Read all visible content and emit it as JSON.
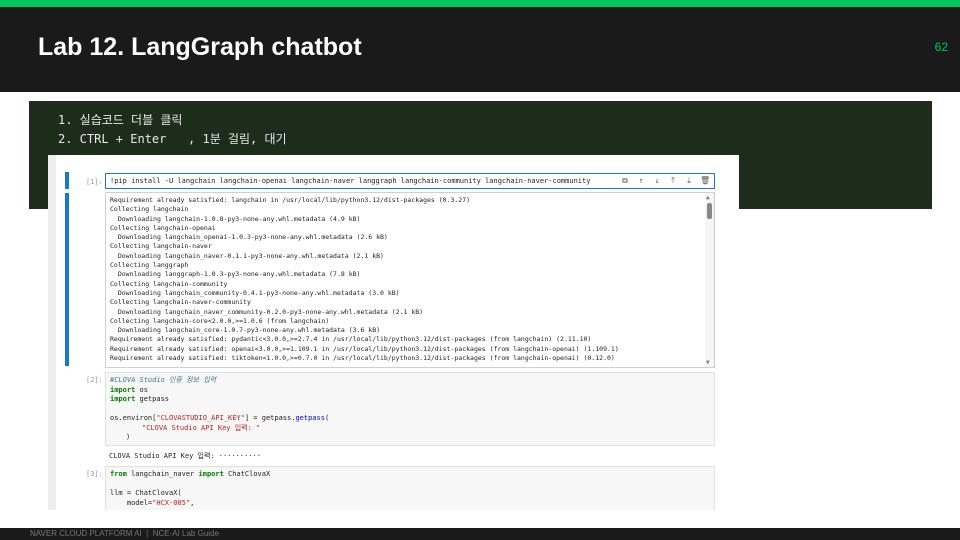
{
  "slide": {
    "title": "Lab 12. LangGraph chatbot",
    "page_number": "62",
    "footer": "NAVER CLOUD PLATFORM AI  |  NCE-AI Lab Guide"
  },
  "instructions": {
    "line1": "1. 실습코드 더블 클릭",
    "line2": "2. CTRL + Enter   , 1분 걸림, 대기"
  },
  "notebook": {
    "cell1": {
      "prompt": "[1]:",
      "code": "!pip install -U langchain langchain-openai langchain-naver langgraph langchain-community langchain-naver-community",
      "toolbar_icons": [
        "copy-icon",
        "arrow-up-icon",
        "arrow-down-icon",
        "insert-above-icon",
        "insert-below-icon",
        "delete-icon"
      ],
      "output": [
        "Requirement already satisfied: langchain in /usr/local/lib/python3.12/dist-packages (0.3.27)",
        "Collecting langchain",
        "  Downloading langchain-1.0.8-py3-none-any.whl.metadata (4.9 kB)",
        "Collecting langchain-openai",
        "  Downloading langchain_openai-1.0.3-py3-none-any.whl.metadata (2.6 kB)",
        "Collecting langchain-naver",
        "  Downloading langchain_naver-0.1.1-py3-none-any.whl.metadata (2.1 kB)",
        "Collecting langgraph",
        "  Downloading langgraph-1.0.3-py3-none-any.whl.metadata (7.8 kB)",
        "Collecting langchain-community",
        "  Downloading langchain_community-0.4.1-py3-none-any.whl.metadata (3.0 kB)",
        "Collecting langchain-naver-community",
        "  Downloading langchain_naver_community-0.2.0-py3-none-any.whl.metadata (2.1 kB)",
        "Collecting langchain-core<2.0.0,>=1.0.6 (from langchain)",
        "  Downloading langchain_core-1.0.7-py3-none-any.whl.metadata (3.6 kB)",
        "Requirement already satisfied: pydantic<3.0.0,>=2.7.4 in /usr/local/lib/python3.12/dist-packages (from langchain) (2.11.10)",
        "Requirement already satisfied: openai<3.0.0,>=1.109.1 in /usr/local/lib/python3.12/dist-packages (from langchain-openai) (1.109.1)",
        "Requirement already satisfied: tiktoken<1.0.0,>=0.7.0 in /usr/local/lib/python3.12/dist-packages (from langchain-openai) (0.12.0)"
      ]
    },
    "cell2": {
      "prompt": "[2]:",
      "comment": "#CLOVA Studio 인증 정보 입력",
      "import1_kw": "import",
      "import1_mod": " os",
      "import2_kw": "import",
      "import2_mod": " getpass",
      "line_environ_a": "os.environ[",
      "line_environ_key": "\"CLOVASTUDIO_API_KEY\"",
      "line_environ_b": "] = getpass.",
      "line_environ_fn": "getpass",
      "line_environ_c": "(",
      "line_prompt_str": "\"CLOVA Studio API Key 입력: \"",
      "line_close": ")",
      "output": "CLOVA Studio API Key 입력: ··········"
    },
    "cell3": {
      "prompt": "[3]:",
      "from_kw": "from",
      "from_mod": " langchain_naver ",
      "import_kw": "import",
      "import_name": " ChatClovaX",
      "llm_line": "llm = ChatClovaX(",
      "model_a": "    model=",
      "model_str": "\"HCX-005\"",
      "model_b": ","
    }
  }
}
